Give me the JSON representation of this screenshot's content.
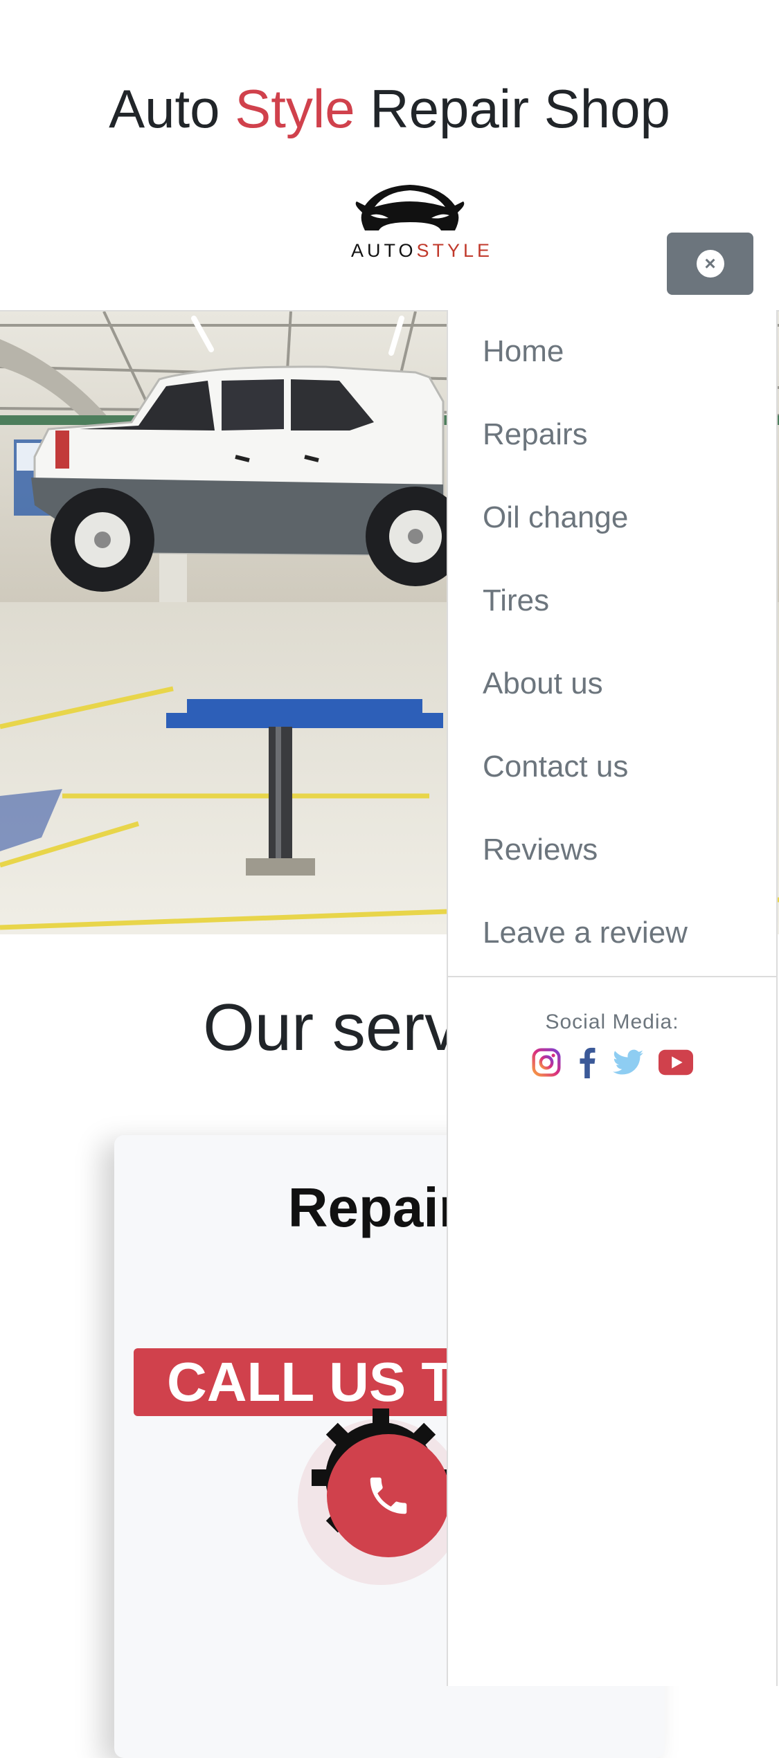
{
  "header": {
    "title_part1": "Auto ",
    "title_accent": "Style",
    "title_part2": " Repair Shop",
    "logo_text_1": "AUTO",
    "logo_text_2": "STYLE",
    "close_symbol": "×"
  },
  "services": {
    "heading": "Our services",
    "card_title": "Repairs",
    "call_banner": "CALL US TODAY"
  },
  "drawer": {
    "menu": [
      {
        "label": "Home"
      },
      {
        "label": "Repairs"
      },
      {
        "label": "Oil change"
      },
      {
        "label": "Tires"
      },
      {
        "label": "About us"
      },
      {
        "label": "Contact us"
      },
      {
        "label": "Reviews"
      },
      {
        "label": "Leave a review"
      }
    ],
    "social_label": "Social Media:",
    "social_icons": [
      "instagram-icon",
      "facebook-icon",
      "twitter-icon",
      "youtube-icon"
    ]
  },
  "colors": {
    "accent": "#d0414c",
    "menu_text": "#6c757d",
    "close_button": "#6c757d"
  }
}
